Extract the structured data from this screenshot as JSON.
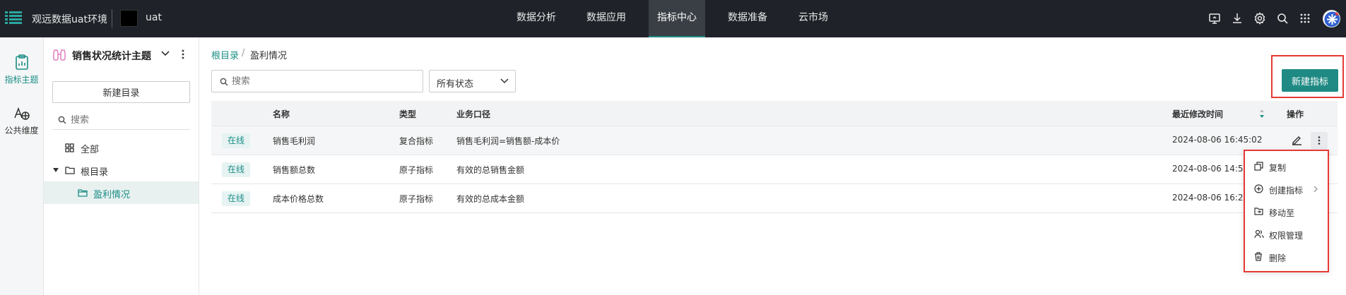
{
  "topbar": {
    "app_title": "观远数据uat环境",
    "env_label": "uat",
    "nav": [
      {
        "label": "数据分析",
        "active": false
      },
      {
        "label": "数据应用",
        "active": false
      },
      {
        "label": "指标中心",
        "active": true
      },
      {
        "label": "数据准备",
        "active": false
      },
      {
        "label": "云市场",
        "active": false
      }
    ],
    "icons": [
      "screen-share-icon",
      "download-icon",
      "gear-icon",
      "search-icon",
      "app-grid-icon"
    ]
  },
  "rail": [
    {
      "label": "指标主题",
      "icon": "clipboard-chart-icon",
      "active": true
    },
    {
      "label": "公共维度",
      "icon": "dimension-icon",
      "active": false
    }
  ],
  "tree": {
    "theme_title": "销售状况统计主题",
    "new_folder_label": "新建目录",
    "search_placeholder": "搜索",
    "items": [
      {
        "label": "全部",
        "icon": "grid-icon"
      },
      {
        "label": "根目录",
        "icon": "folder-icon"
      },
      {
        "label": "盈利情况",
        "icon": "folder-icon",
        "selected": true
      }
    ]
  },
  "main": {
    "breadcrumb": {
      "root": "根目录",
      "separator": "/",
      "current": "盈利情况"
    },
    "search_placeholder": "搜索",
    "status_filter": "所有状态",
    "new_metric_label": "新建指标",
    "table": {
      "columns": [
        "名称",
        "类型",
        "业务口径",
        "最近修改时间",
        "操作"
      ],
      "rows": [
        {
          "status": "在线",
          "name": "销售毛利润",
          "type": "复合指标",
          "definition": "销售毛利润=销售额-成本价",
          "modified": "2024-08-06 16:45:02"
        },
        {
          "status": "在线",
          "name": "销售额总数",
          "type": "原子指标",
          "definition": "有效的总销售金额",
          "modified": "2024-08-06 14:5"
        },
        {
          "status": "在线",
          "name": "成本价格总数",
          "type": "原子指标",
          "definition": "有效的总成本金额",
          "modified": "2024-08-06 16:2"
        }
      ]
    },
    "row_menu": [
      {
        "label": "复制",
        "icon": "copy-icon"
      },
      {
        "label": "创建指标",
        "icon": "plus-circle-icon",
        "has_submenu": true
      },
      {
        "label": "移动至",
        "icon": "folder-move-icon"
      },
      {
        "label": "权限管理",
        "icon": "users-icon"
      },
      {
        "label": "删除",
        "icon": "trash-icon"
      }
    ]
  },
  "colors": {
    "accent": "#1f8a84",
    "topbar": "#1f2329",
    "highlight": "#e53935"
  }
}
